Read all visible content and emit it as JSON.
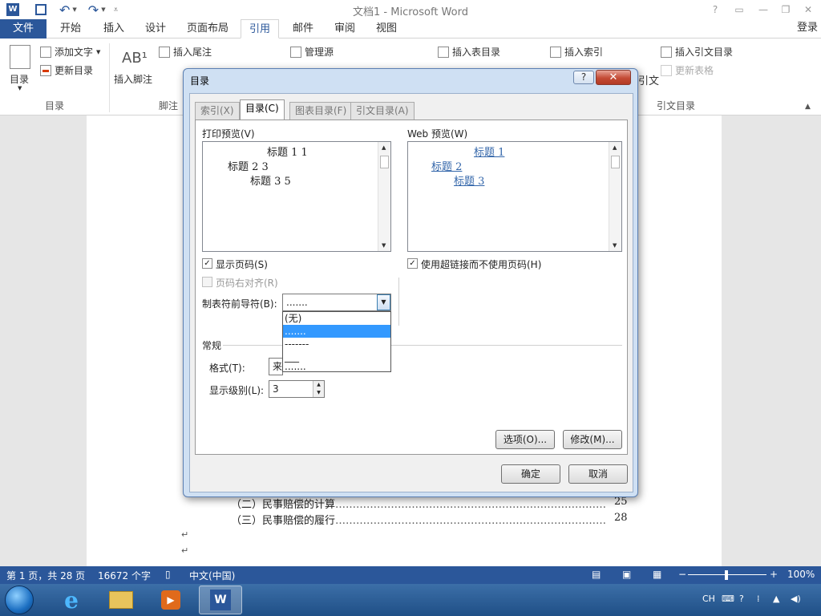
{
  "window": {
    "title": "文档1 - Microsoft Word",
    "help": "?",
    "login": "登录"
  },
  "tabs": [
    "文件",
    "开始",
    "插入",
    "设计",
    "页面布局",
    "引用",
    "邮件",
    "审阅",
    "视图"
  ],
  "ribbon": {
    "toc_group": {
      "toc_button": "目录",
      "add_text": "添加文字",
      "update_toc": "更新目录",
      "label": "目录"
    },
    "footnote_group": {
      "insert_footnote": "插入脚注",
      "insert_endnote": "插入尾注",
      "label": "脚注"
    },
    "citation_group": {
      "manage_sources": "管理源"
    },
    "caption_group": {
      "insert_table_of_figures": "插入表目录"
    },
    "index_group": {
      "insert_index": "插入索引"
    },
    "toa_group": {
      "mark_citation_partial": "引文",
      "insert_toa": "插入引文目录",
      "update_table": "更新表格",
      "label": "引文目录"
    }
  },
  "document": {
    "toc_lines": [
      {
        "text": "（二）民事赔偿的计算",
        "page": "25"
      },
      {
        "text": "（三）民事赔偿的履行",
        "page": "28"
      }
    ]
  },
  "statusbar": {
    "page": "第 1 页，共 28 页",
    "words": "16672 个字",
    "language": "中文(中国)",
    "zoom": "100%"
  },
  "taskbar": {
    "tray_lang": "CH"
  },
  "dialog": {
    "title": "目录",
    "tabs": [
      "索引(X)",
      "目录(C)",
      "图表目录(F)",
      "引文目录(A)"
    ],
    "active_tab": "目录(C)",
    "print_preview_label": "打印预览(V)",
    "web_preview_label": "Web 预览(W)",
    "print_preview_lines": [
      {
        "text": "标题 1 1"
      },
      {
        "text": "标题 2 3"
      },
      {
        "text": "标题 3 5"
      }
    ],
    "web_preview_lines": [
      "标题 1",
      "标题 2",
      "标题 3"
    ],
    "show_page_numbers": {
      "label": "显示页码(S)",
      "checked": true
    },
    "right_align": {
      "label": "页码右对齐(R)",
      "checked": false
    },
    "use_hyperlinks": {
      "label": "使用超链接而不使用页码(H)",
      "checked": true
    },
    "tab_leader_label": "制表符前导符(B):",
    "tab_leader_value": ".......",
    "tab_leader_options": [
      "(无)",
      ".......",
      "-------",
      "___",
      "......."
    ],
    "tab_leader_selected_index": 1,
    "general_label": "常规",
    "format_label": "格式(T):",
    "format_value": "来",
    "levels_label": "显示级别(L):",
    "levels_value": "3",
    "options_button": "选项(O)...",
    "modify_button": "修改(M)...",
    "ok_button": "确定",
    "cancel_button": "取消"
  },
  "colors": {
    "word_blue": "#2b579a",
    "link_blue": "#3366aa",
    "selection": "#3399ff"
  }
}
